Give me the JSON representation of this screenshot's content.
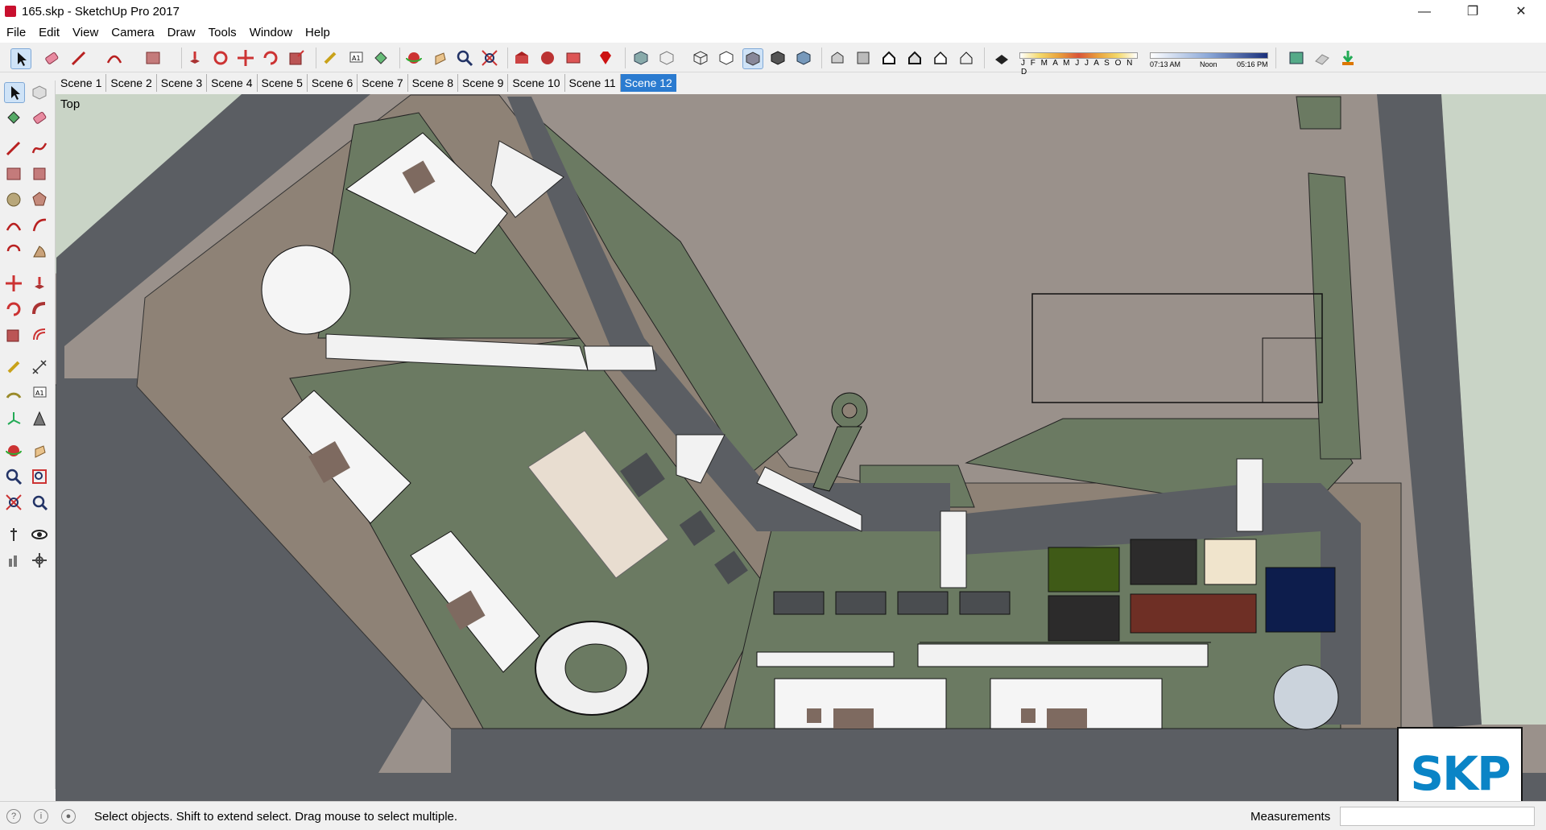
{
  "window": {
    "title": "165.skp - SketchUp Pro 2017",
    "minimize_icon": "minimize-icon",
    "maximize_icon": "restore-icon",
    "close_icon": "close-icon"
  },
  "menu": [
    "File",
    "Edit",
    "View",
    "Camera",
    "Draw",
    "Tools",
    "Window",
    "Help"
  ],
  "shadow_settings": {
    "months": "J F M A M J J A S O N D",
    "time_start": "07:13 AM",
    "time_mid": "Noon",
    "time_end": "05:16 PM"
  },
  "scenes": [
    "Scene 1",
    "Scene 2",
    "Scene 3",
    "Scene 4",
    "Scene 5",
    "Scene 6",
    "Scene 7",
    "Scene 8",
    "Scene 9",
    "Scene 10",
    "Scene 11",
    "Scene 12"
  ],
  "active_scene": "Scene 12",
  "viewport": {
    "view_label": "Top"
  },
  "status": {
    "hint": "Select objects. Shift to extend select. Drag mouse to select multiple.",
    "measurements_label": "Measurements",
    "measurements_value": ""
  },
  "badge": {
    "text": "SKP"
  },
  "colors": {
    "ground": "#9a918b",
    "road": "#5b5e63",
    "grass": "#6b7a62",
    "lawn_light": "#c9d4c6",
    "paving": "#8e8276",
    "accent_blue": "#2b7bd0",
    "skp_blue": "#0a84c6"
  }
}
